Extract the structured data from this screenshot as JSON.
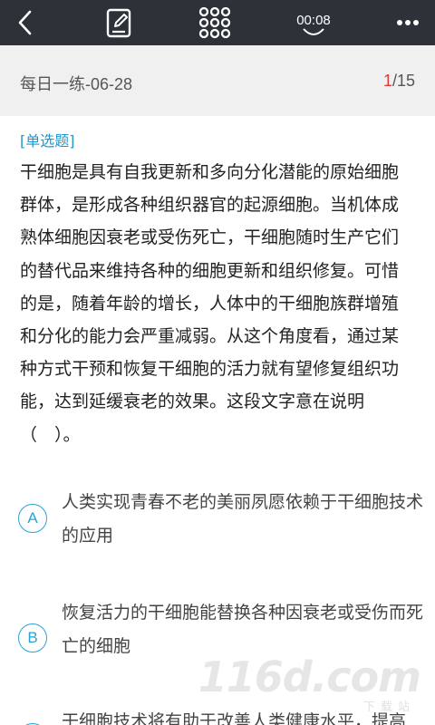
{
  "topbar": {
    "timer": "00:08",
    "back_icon": "chevron-left-icon",
    "note_icon": "edit-note-icon",
    "grid_icon": "grid-dots-icon",
    "more_icon": "more-dots-icon"
  },
  "progress": {
    "title": "每日一练-06-28",
    "current": "1",
    "total": "/15"
  },
  "question": {
    "type": "[单选题]",
    "stem": "干细胞是具有自我更新和多向分化潜能的原始细胞群体，是形成各种组织器官的起源细胞。当机体成熟体细胞因衰老或受伤死亡，干细胞随时生产它们的替代品来维持各种的细胞更新和组织修复。可惜的是，随着年龄的增长，人体中的干细胞族群增殖和分化的能力会严重减弱。从这个角度看，通过某种方式干预和恢复干细胞的活力就有望修复组织功能，达到延缓衰老的效果。这段文字意在说明（　）。"
  },
  "options": [
    {
      "letter": "A",
      "text": "人类实现青春不老的美丽夙愿依赖于干细胞技术的应用"
    },
    {
      "letter": "B",
      "text": "恢复活力的干细胞能替换各种因衰老或受伤而死亡的细胞"
    },
    {
      "letter": "C",
      "text": "干细胞技术将有助于改善人类健康水平，提高"
    }
  ],
  "watermark": {
    "main": "116d.com",
    "sub": "下载站"
  },
  "colors": {
    "topbar_bg": "#2d3238",
    "accent": "#2aa3d6",
    "current_page": "#e53935"
  }
}
